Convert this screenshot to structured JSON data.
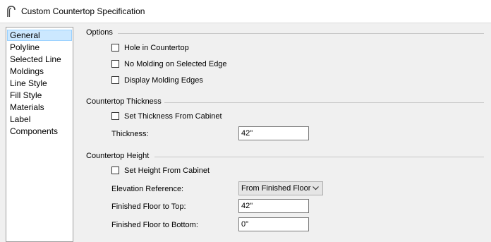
{
  "window": {
    "title": "Custom Countertop Specification"
  },
  "sidebar": {
    "items": [
      {
        "label": "General",
        "selected": true
      },
      {
        "label": "Polyline"
      },
      {
        "label": "Selected Line"
      },
      {
        "label": "Moldings"
      },
      {
        "label": "Line Style"
      },
      {
        "label": "Fill Style"
      },
      {
        "label": "Materials"
      },
      {
        "label": "Label"
      },
      {
        "label": "Components"
      }
    ]
  },
  "options": {
    "heading": "Options",
    "hole": {
      "label": "Hole in Countertop",
      "checked": false
    },
    "no_molding": {
      "label": "No Molding on Selected Edge",
      "checked": false
    },
    "display_edges": {
      "label": "Display Molding Edges",
      "checked": false
    }
  },
  "thickness": {
    "heading": "Countertop Thickness",
    "from_cabinet": {
      "label": "Set Thickness From Cabinet",
      "checked": false
    },
    "label": "Thickness:",
    "value": "42\""
  },
  "height": {
    "heading": "Countertop Height",
    "from_cabinet": {
      "label": "Set Height From Cabinet",
      "checked": false
    },
    "elevation_ref": {
      "label": "Elevation Reference:",
      "value": "From Finished Floor"
    },
    "to_top": {
      "label": "Finished Floor to Top:",
      "value": "42\""
    },
    "to_bottom": {
      "label": "Finished Floor to Bottom:",
      "value": "0\""
    }
  },
  "colors": {
    "selection_bg": "#cce8ff",
    "selection_border": "#99d1ff",
    "dialog_bg": "#f0f0f0"
  }
}
